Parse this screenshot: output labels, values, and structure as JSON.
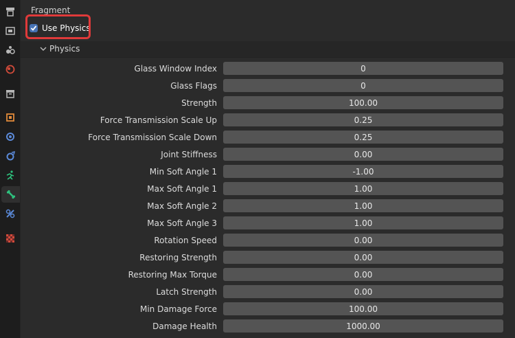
{
  "sidebar": {
    "tabs": [
      {
        "name": "tool-icon",
        "color": "#b8b8b8"
      },
      {
        "name": "render-icon",
        "color": "#b8b8b8"
      },
      {
        "name": "output-icon",
        "color": "#b8b8b8"
      },
      {
        "name": "scene-icon",
        "color": "#b8b8b8"
      },
      {
        "name": "world-icon",
        "color": "#d24b3a"
      },
      {
        "name": "collection-icon",
        "color": "#b8b8b8"
      },
      {
        "name": "object-icon",
        "color": "#e08a3a"
      },
      {
        "name": "modifiers-icon",
        "color": "#5b8ad9"
      },
      {
        "name": "particles-icon",
        "color": "#5b8ad9"
      },
      {
        "name": "physics-icon",
        "color": "#2ec27e"
      },
      {
        "name": "bone-icon",
        "color": "#2ec27e"
      },
      {
        "name": "constraints-icon",
        "color": "#5b8ad9"
      },
      {
        "name": "texture-icon",
        "color": "#d24b3a"
      }
    ],
    "active_index": 10
  },
  "section": {
    "title": "Fragment",
    "use_physics_label": "Use Physics",
    "use_physics_checked": true
  },
  "subpanel": {
    "title": "Physics"
  },
  "properties": [
    {
      "label": "Glass Window Index",
      "value": "0"
    },
    {
      "label": "Glass Flags",
      "value": "0"
    },
    {
      "label": "Strength",
      "value": "100.00"
    },
    {
      "label": "Force Transmission Scale Up",
      "value": "0.25"
    },
    {
      "label": "Force Transmission Scale Down",
      "value": "0.25"
    },
    {
      "label": "Joint Stiffness",
      "value": "0.00"
    },
    {
      "label": "Min Soft Angle 1",
      "value": "-1.00"
    },
    {
      "label": "Max Soft Angle 1",
      "value": "1.00"
    },
    {
      "label": "Max Soft Angle 2",
      "value": "1.00"
    },
    {
      "label": "Max Soft Angle 3",
      "value": "1.00"
    },
    {
      "label": "Rotation Speed",
      "value": "0.00"
    },
    {
      "label": "Restoring Strength",
      "value": "0.00"
    },
    {
      "label": "Restoring Max Torque",
      "value": "0.00"
    },
    {
      "label": "Latch Strength",
      "value": "0.00"
    },
    {
      "label": "Min Damage Force",
      "value": "100.00"
    },
    {
      "label": "Damage Health",
      "value": "1000.00"
    }
  ],
  "colors": {
    "accent": "#4772b3",
    "highlight": "#e03a3a"
  }
}
